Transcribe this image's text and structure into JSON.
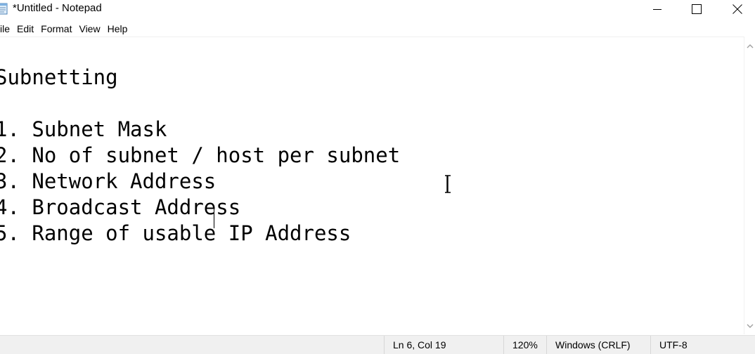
{
  "window": {
    "title": "*Untitled - Notepad",
    "app_icon": "notepad-icon",
    "caption_buttons": [
      "minimize-icon",
      "maximize-icon",
      "close-icon"
    ]
  },
  "menubar": {
    "items": [
      "ile",
      "Edit",
      "Format",
      "View",
      "Help"
    ]
  },
  "editor": {
    "content": "Subnetting\n\n1. Subnet Mask\n2. No of subnet / host per subnet\n3. Network Address\n4. Broadcast Address\n5. Range of usable IP Address"
  },
  "statusbar": {
    "position": "Ln 6, Col 19",
    "zoom": "120%",
    "line_ending": "Windows (CRLF)",
    "encoding": "UTF-8"
  }
}
